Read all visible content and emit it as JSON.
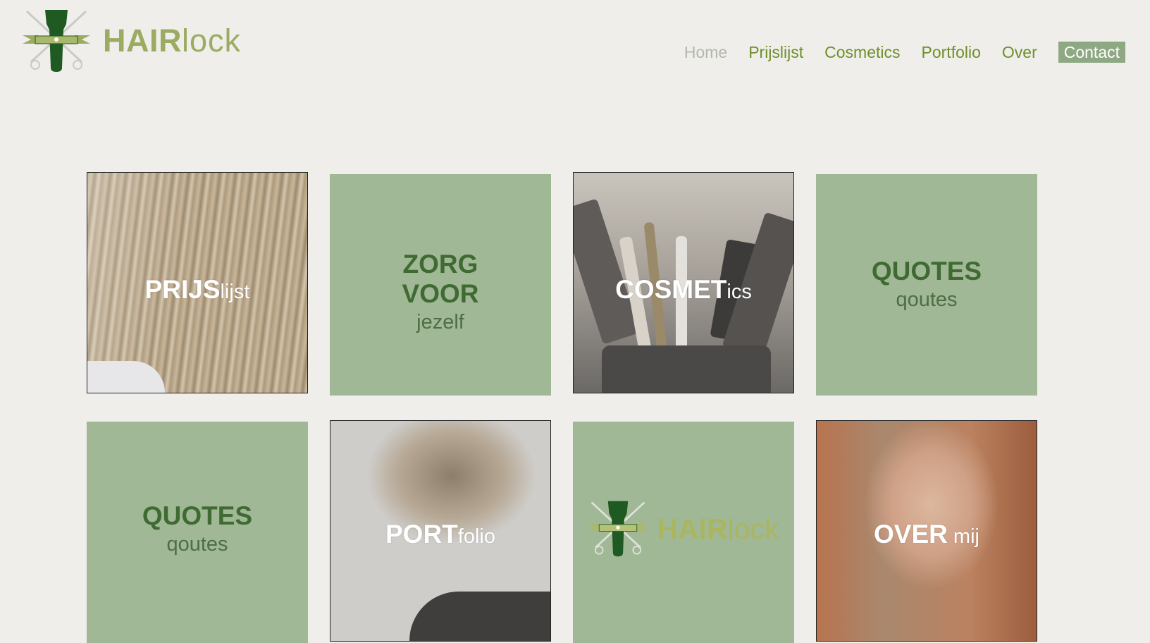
{
  "header": {
    "logo": {
      "bold": "HAIR",
      "light": "lock"
    },
    "nav": [
      {
        "label": "Home",
        "active": true
      },
      {
        "label": "Prijslijst"
      },
      {
        "label": "Cosmetics"
      },
      {
        "label": "Portfolio"
      },
      {
        "label": "Over"
      },
      {
        "label": "Contact",
        "highlight": true
      }
    ]
  },
  "tiles": {
    "prijslijst": {
      "big": "PRIJS",
      "small": "lijst"
    },
    "zorg": {
      "line1": "ZORG",
      "line2": "VOOR",
      "small": "jezelf"
    },
    "cosmetics": {
      "big": "COSMET",
      "small": "ics"
    },
    "quotes1": {
      "big": "QUOTES",
      "small": "qoutes"
    },
    "quotes2": {
      "big": "QUOTES",
      "small": "qoutes"
    },
    "portfolio": {
      "big": "PORT",
      "small": "folio"
    },
    "logo_tile": {
      "bold": "HAIR",
      "light": "lock"
    },
    "over": {
      "big": "OVER",
      "small": " mij"
    }
  },
  "colors": {
    "background": "#efeeeb",
    "tile_green": "#a1b896",
    "nav_green": "#6f8f2a",
    "logo_green": "#9bac62",
    "dark_green": "#1e5a22"
  }
}
